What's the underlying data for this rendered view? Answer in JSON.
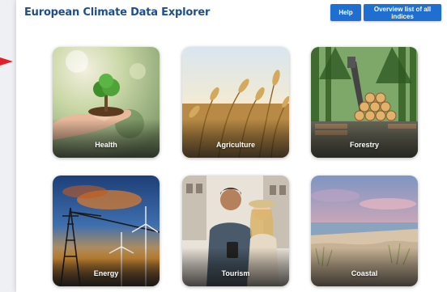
{
  "header": {
    "title": "European Climate Data Explorer",
    "help_label": "Help",
    "overview_label": "Overview list of all indices"
  },
  "colors": {
    "title": "#1f4e8c",
    "button": "#1e6fd0",
    "arrow": "#e3202a"
  },
  "cards": [
    {
      "id": "health",
      "label": "Health"
    },
    {
      "id": "agriculture",
      "label": "Agriculture"
    },
    {
      "id": "forestry",
      "label": "Forestry"
    },
    {
      "id": "energy",
      "label": "Energy"
    },
    {
      "id": "tourism",
      "label": "Tourism"
    },
    {
      "id": "coastal",
      "label": "Coastal"
    }
  ]
}
